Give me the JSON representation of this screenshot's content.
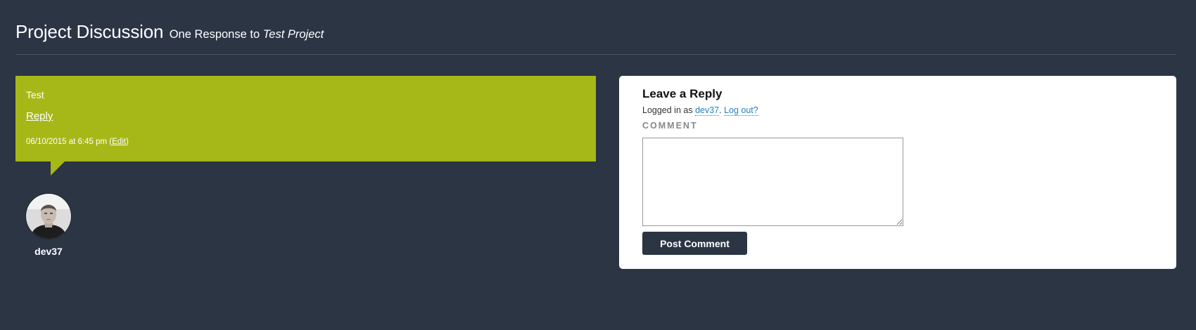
{
  "header": {
    "title": "Project Discussion",
    "subtitle_prefix": "One Response to ",
    "subtitle_project": "Test Project"
  },
  "comment": {
    "text": "Test",
    "reply_label": "Reply",
    "timestamp": "06/10/2015 at 6:45 pm",
    "edit_open": " (",
    "edit_label": "Edit",
    "edit_close": ")",
    "author": "dev37",
    "bubble_color": "#a6b818"
  },
  "reply_form": {
    "heading": "Leave a Reply",
    "logged_in_prefix": "Logged in as ",
    "username": "dev37",
    "separator": ". ",
    "logout_label": "Log out?",
    "comment_label": "COMMENT",
    "comment_value": "",
    "submit_label": "Post Comment"
  },
  "colors": {
    "background": "#2b3544",
    "link": "#1e84c0"
  }
}
